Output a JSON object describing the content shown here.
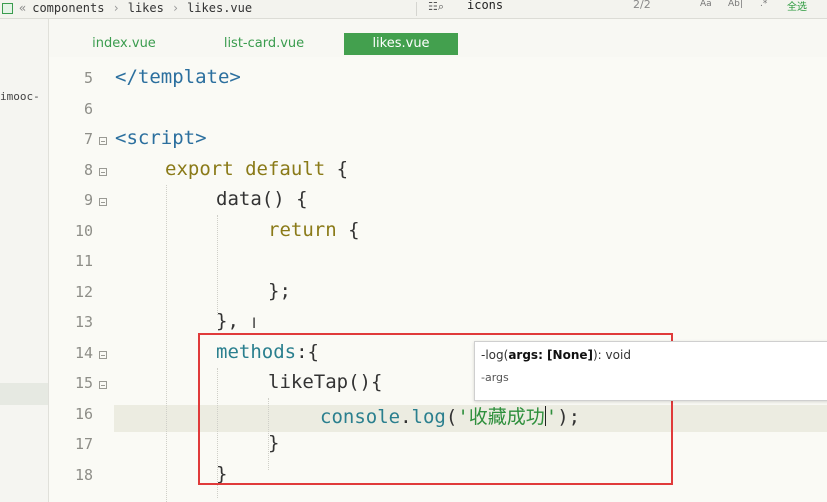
{
  "breadcrumb": {
    "back": "«",
    "items": [
      "components",
      "likes",
      "likes.vue"
    ]
  },
  "find": {
    "icon": "find-icon",
    "query": "icons",
    "match_count": "2/2",
    "option_case": "Aa",
    "option_word": "Ab|",
    "option_regex": ".*",
    "select_all": "全选"
  },
  "sidebar": {
    "project_label": "imooc-"
  },
  "tabs": [
    {
      "label": "index.vue",
      "active": false
    },
    {
      "label": "list-card.vue",
      "active": false
    },
    {
      "label": "likes.vue",
      "active": true
    }
  ],
  "editor": {
    "lines": [
      {
        "num": "5"
      },
      {
        "num": "6"
      },
      {
        "num": "7"
      },
      {
        "num": "8"
      },
      {
        "num": "9"
      },
      {
        "num": "10"
      },
      {
        "num": "11"
      },
      {
        "num": "12"
      },
      {
        "num": "13"
      },
      {
        "num": "14"
      },
      {
        "num": "15"
      },
      {
        "num": "16"
      },
      {
        "num": "17"
      },
      {
        "num": "18"
      }
    ],
    "code": {
      "l5": "</template>",
      "l7": "<script>",
      "l8_kw": "export default",
      "l8_rest": " {",
      "l9": "data() {",
      "l10_kw": "return",
      "l10_rest": " {",
      "l12": "};",
      "l13": "},",
      "l14_prop": "methods",
      "l14_rest": ":{",
      "l15": "likeTap(){",
      "l16_obj": "console",
      "l16_dot": ".",
      "l16_fn": "log",
      "l16_open": "(",
      "l16_str_a": "'收藏成功",
      "l16_str_b": "'",
      "l16_close": ");",
      "l17": "}",
      "l18": "}"
    }
  },
  "tooltip": {
    "prefix": "-",
    "fn": "log",
    "open": "(",
    "args": "args: [None]",
    "close": "): void",
    "param": "-args"
  },
  "colors": {
    "accent": "#43a04e",
    "highlight_box": "#e03a3a"
  }
}
